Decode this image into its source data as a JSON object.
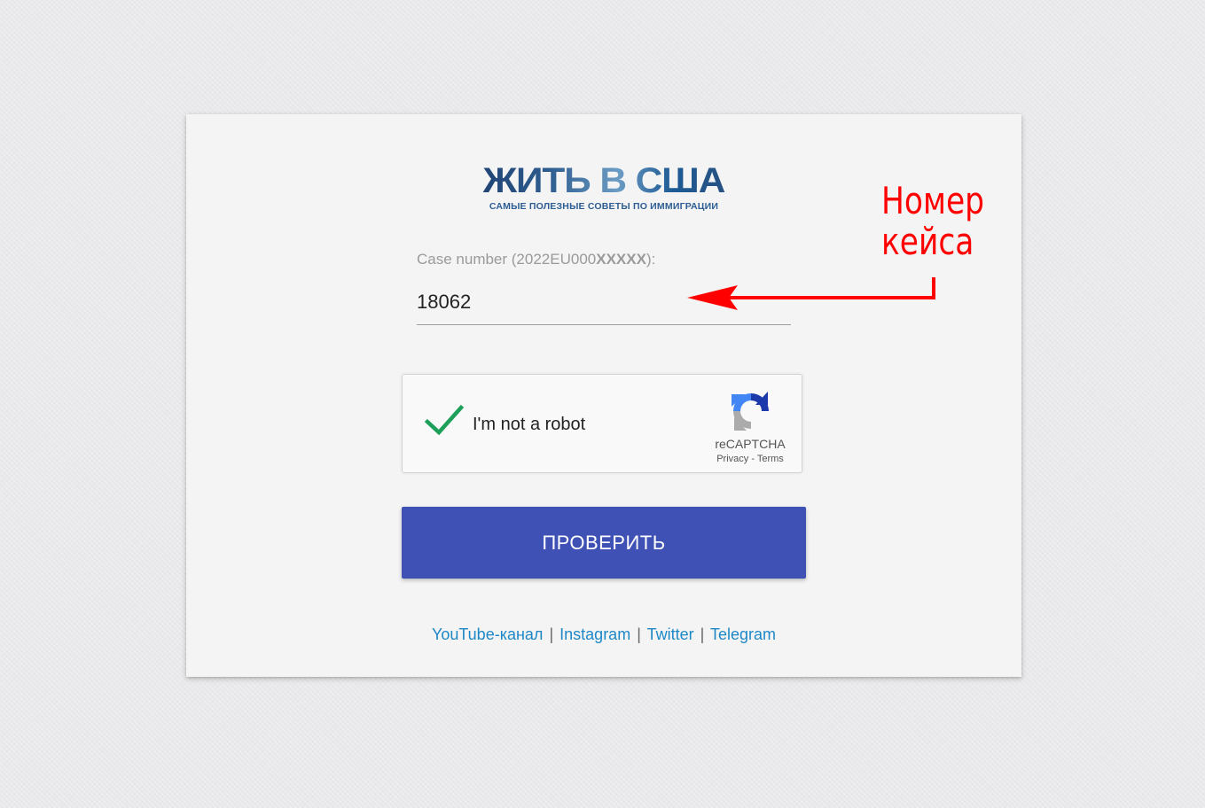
{
  "logo": {
    "title": "ЖИТЬ В США",
    "subtitle": "САМЫЕ ПОЛЕЗНЫЕ СОВЕТЫ ПО ИММИГРАЦИИ"
  },
  "form": {
    "label_prefix": "Case number (2022EU000",
    "label_mask": "XXXXX",
    "label_suffix": "):",
    "case_value": "18062"
  },
  "recaptcha": {
    "label": "I'm not a robot",
    "brand": "reCAPTCHA",
    "privacy": "Privacy",
    "link_sep": "-",
    "terms": "Terms",
    "checked": true
  },
  "submit": {
    "label": "ПРОВЕРИТЬ",
    "color": "#3f51b5"
  },
  "social": {
    "links": [
      "YouTube-канал",
      "Instagram",
      "Twitter",
      "Telegram"
    ],
    "separator": "|"
  },
  "annotation": {
    "line1": "Номер",
    "line2": "кейса",
    "color": "#ff0000"
  }
}
